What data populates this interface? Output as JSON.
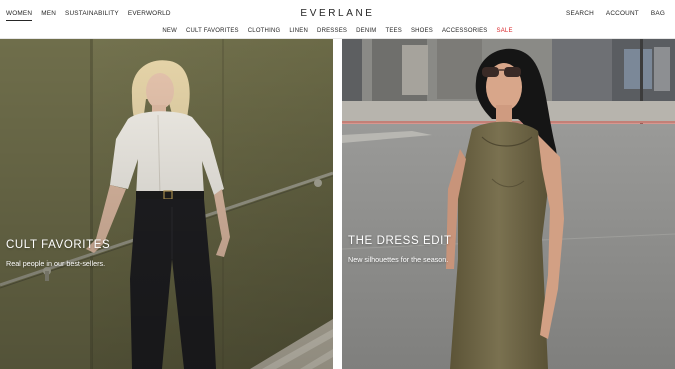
{
  "topnav": {
    "left": [
      "WOMEN",
      "MEN",
      "SUSTAINABILITY",
      "EVERWORLD"
    ],
    "right": [
      "SEARCH",
      "ACCOUNT",
      "BAG"
    ]
  },
  "brand": {
    "logo": "EVERLANE"
  },
  "categories": [
    "NEW",
    "CULT FAVORITES",
    "CLOTHING",
    "LINEN",
    "DRESSES",
    "DENIM",
    "TEES",
    "SHOES",
    "ACCESSORIES",
    "SALE"
  ],
  "colors": {
    "sale": "#d9262a",
    "text": "#262626"
  },
  "promos": [
    {
      "title": "CULT FAVORITES",
      "subtitle": "Real people in our best-sellers."
    },
    {
      "title": "THE DRESS EDIT",
      "subtitle": "New silhouettes for the season."
    }
  ]
}
